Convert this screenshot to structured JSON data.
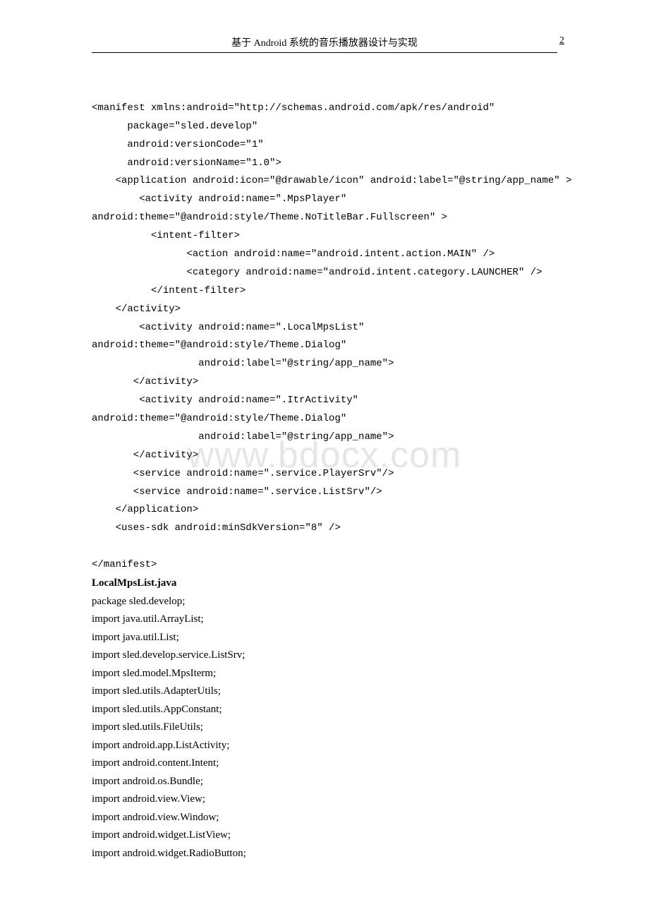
{
  "header": {
    "title": "基于 Android 系统的音乐播放器设计与实现",
    "page": "2"
  },
  "watermark": "www.bdocx.com",
  "xml": {
    "l01": "<manifest xmlns:android=\"http://schemas.android.com/apk/res/android\"",
    "l02": "      package=\"sled.develop\"",
    "l03": "      android:versionCode=\"1\"",
    "l04": "      android:versionName=\"1.0\">",
    "l05": "    <application android:icon=\"@drawable/icon\" android:label=\"@string/app_name\" >",
    "l06": "        <activity android:name=\".MpsPlayer\"",
    "l07": "android:theme=\"@android:style/Theme.NoTitleBar.Fullscreen\" >",
    "l08": "          <intent-filter>",
    "l09": "                <action android:name=\"android.intent.action.MAIN\" />",
    "l10": "                <category android:name=\"android.intent.category.LAUNCHER\" />",
    "l11": "          </intent-filter>",
    "l12": "    </activity>",
    "l13": "        <activity android:name=\".LocalMpsList\"",
    "l14": "android:theme=\"@android:style/Theme.Dialog\"",
    "l15": "                  android:label=\"@string/app_name\">",
    "l16": "       </activity>",
    "l17": "        <activity android:name=\".ItrActivity\"",
    "l18": "android:theme=\"@android:style/Theme.Dialog\"",
    "l19": "                  android:label=\"@string/app_name\">",
    "l20": "       </activity>",
    "l21": "       <service android:name=\".service.PlayerSrv\"/>",
    "l22": "       <service android:name=\".service.ListSrv\"/>",
    "l23": "    </application>",
    "l24": "    <uses-sdk android:minSdkVersion=\"8\" />",
    "l25": "",
    "l26": "</manifest>"
  },
  "java": {
    "filename": "LocalMpsList.java",
    "l01": "package sled.develop;",
    "l02": "",
    "l03": "import java.util.ArrayList;",
    "l04": "import java.util.List;",
    "l05": "",
    "l06": "import sled.develop.service.ListSrv;",
    "l07": "import sled.model.MpsIterm;",
    "l08": "import sled.utils.AdapterUtils;",
    "l09": "import sled.utils.AppConstant;",
    "l10": "import sled.utils.FileUtils;",
    "l11": "import android.app.ListActivity;",
    "l12": "import android.content.Intent;",
    "l13": "import android.os.Bundle;",
    "l14": "import android.view.View;",
    "l15": "import android.view.Window;",
    "l16": "import android.widget.ListView;",
    "l17": "import android.widget.RadioButton;"
  }
}
